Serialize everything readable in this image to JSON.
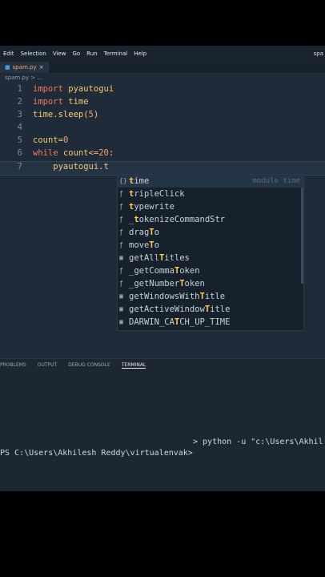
{
  "menu": [
    "Edit",
    "Selection",
    "View",
    "Go",
    "Run",
    "Terminal",
    "Help"
  ],
  "window_title_fragment": "spa",
  "tab": {
    "label": "spam.py",
    "close": "×"
  },
  "breadcrumb": "spam.py > ...",
  "code_lines": [
    {
      "num": "1",
      "parts": [
        {
          "t": "import ",
          "c": "kw"
        },
        {
          "t": "pyautogui",
          "c": "id"
        }
      ]
    },
    {
      "num": "2",
      "parts": [
        {
          "t": "import ",
          "c": "kw"
        },
        {
          "t": "time",
          "c": "id"
        }
      ]
    },
    {
      "num": "3",
      "parts": [
        {
          "t": "time.",
          "c": "id"
        },
        {
          "t": "sleep",
          "c": "fn"
        },
        {
          "t": "(",
          "c": "id"
        },
        {
          "t": "5",
          "c": "num"
        },
        {
          "t": ")",
          "c": "id"
        }
      ]
    },
    {
      "num": "4",
      "parts": []
    },
    {
      "num": "5",
      "parts": [
        {
          "t": "count",
          "c": "id"
        },
        {
          "t": "=",
          "c": "op"
        },
        {
          "t": "0",
          "c": "num"
        }
      ]
    },
    {
      "num": "6",
      "parts": [
        {
          "t": "while ",
          "c": "kw"
        },
        {
          "t": "count",
          "c": "id"
        },
        {
          "t": "<=",
          "c": "op"
        },
        {
          "t": "20",
          "c": "num"
        },
        {
          "t": ":",
          "c": "id"
        }
      ]
    },
    {
      "num": "7",
      "parts": [
        {
          "t": "    pyautogui.t",
          "c": "id"
        }
      ]
    }
  ],
  "suggestions": [
    {
      "icon": "{}",
      "pre": "",
      "hl": "t",
      "post": "ime",
      "detail": "module time"
    },
    {
      "icon": "ƒ",
      "pre": "",
      "hl": "t",
      "post": "ripleClick",
      "detail": ""
    },
    {
      "icon": "ƒ",
      "pre": "",
      "hl": "t",
      "post": "ypewrite",
      "detail": ""
    },
    {
      "icon": "ƒ",
      "pre": "_",
      "hl": "t",
      "post": "okenizeCommandStr",
      "detail": ""
    },
    {
      "icon": "ƒ",
      "pre": "drag",
      "hl": "T",
      "post": "o",
      "detail": ""
    },
    {
      "icon": "ƒ",
      "pre": "move",
      "hl": "T",
      "post": "o",
      "detail": ""
    },
    {
      "icon": "▣",
      "pre": "getAll",
      "hl": "T",
      "post": "itles",
      "detail": ""
    },
    {
      "icon": "ƒ",
      "pre": "_getComma",
      "hl": "T",
      "post": "oken",
      "detail": ""
    },
    {
      "icon": "ƒ",
      "pre": "_getNumber",
      "hl": "T",
      "post": "oken",
      "detail": ""
    },
    {
      "icon": "▣",
      "pre": "getWindowsWith",
      "hl": "T",
      "post": "itle",
      "detail": ""
    },
    {
      "icon": "▣",
      "pre": "getActiveWindow",
      "hl": "T",
      "post": "itle",
      "detail": ""
    },
    {
      "icon": "▣",
      "pre": "DARWIN_CA",
      "hl": "T",
      "post": "CH_UP_TIME",
      "detail": ""
    }
  ],
  "panel_tabs": [
    "PROBLEMS",
    "OUTPUT",
    "DEBUG CONSOLE",
    "TERMINAL"
  ],
  "terminal": {
    "line1": "> python -u \"c:\\Users\\Akhil",
    "line2": "PS C:\\Users\\Akhilesh Reddy\\virtualenvak>"
  },
  "taskbar": [
    "windows-start-icon",
    "search-icon",
    "task-view-icon",
    "widgets-icon"
  ]
}
